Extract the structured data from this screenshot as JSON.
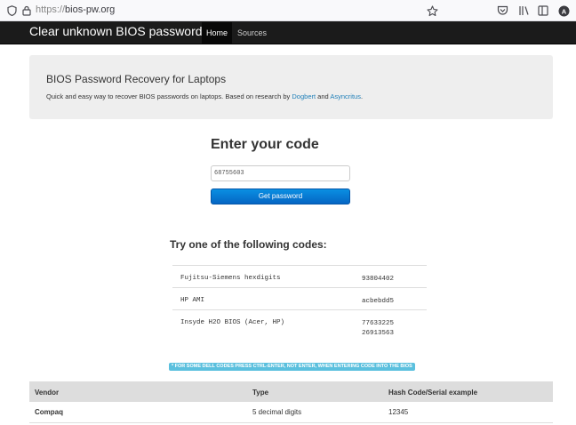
{
  "browser": {
    "url_proto": "https://",
    "url_host": "bios-pw.org"
  },
  "navbar": {
    "brand": "Clear unknown BIOS passwords",
    "items": [
      {
        "label": "Home",
        "active": true
      },
      {
        "label": "Sources",
        "active": false
      }
    ]
  },
  "jumbotron": {
    "title": "BIOS Password Recovery for Laptops",
    "desc_prefix": "Quick and easy way to recover BIOS passwords on laptops. Based on research by ",
    "link1": "Dogbert",
    "desc_and": " and ",
    "link2": "Asyncritus",
    "desc_suffix": "."
  },
  "form": {
    "title": "Enter your code",
    "input_value": "68755603",
    "button_label": "Get password"
  },
  "try": {
    "title": "Try one of the following codes:",
    "rows": [
      {
        "name": "Fujitsu-Siemens hexdigits",
        "codes": [
          "93804402"
        ]
      },
      {
        "name": "HP AMI",
        "codes": [
          "acbebdd5"
        ]
      },
      {
        "name": "Insyde H2O BIOS (Acer, HP)",
        "codes": [
          "77633225",
          "26913563"
        ]
      }
    ]
  },
  "dell_note": "* FOR SOME DELL CODES PRESS CTRL-ENTER, NOT ENTER, WHEN ENTERING CODE INTO THE BIOS",
  "vendor_table": {
    "headers": [
      "Vendor",
      "Type",
      "Hash Code/Serial example"
    ],
    "rows": [
      [
        "Compaq",
        "5 decimal digits",
        "12345"
      ]
    ]
  }
}
